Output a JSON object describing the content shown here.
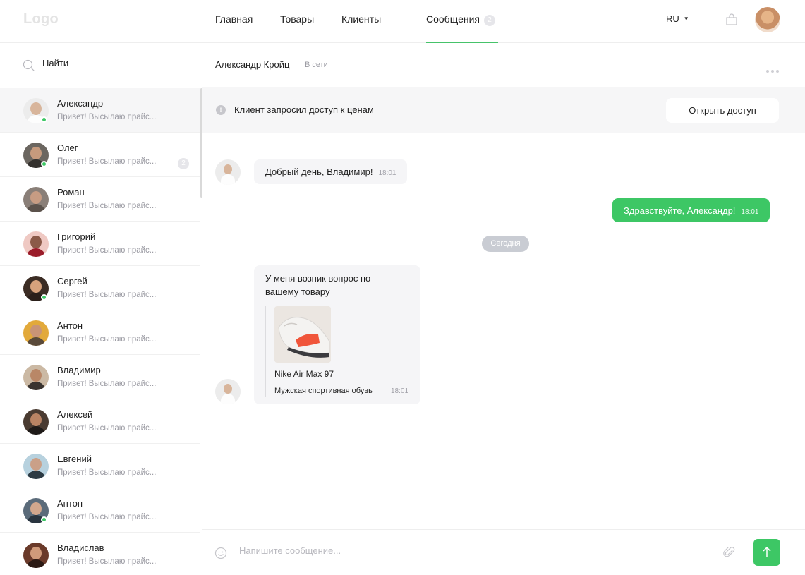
{
  "header": {
    "logo": "Logo",
    "nav": [
      {
        "label": "Главная"
      },
      {
        "label": "Товары"
      },
      {
        "label": "Клиенты"
      },
      {
        "label": "Сообщения",
        "badge": "2",
        "active": true
      }
    ],
    "language": "RU",
    "icons": {
      "cart": "shopping-bag-icon",
      "caret": "caret-down-icon"
    }
  },
  "sidebar": {
    "search_placeholder": "Найти",
    "contacts": [
      {
        "name": "Александр",
        "preview": "Привет! Высылаю прайс...",
        "online": true,
        "active": true
      },
      {
        "name": "Олег",
        "preview": "Привет! Высылаю прайс...",
        "online": true,
        "unread": "2"
      },
      {
        "name": "Роман",
        "preview": "Привет! Высылаю прайс..."
      },
      {
        "name": "Григорий",
        "preview": "Привет! Высылаю прайс..."
      },
      {
        "name": "Сергей",
        "preview": "Привет! Высылаю прайс...",
        "online": true
      },
      {
        "name": "Антон",
        "preview": "Привет! Высылаю прайс..."
      },
      {
        "name": "Владимир",
        "preview": "Привет! Высылаю прайс..."
      },
      {
        "name": "Алексей",
        "preview": "Привет! Высылаю прайс..."
      },
      {
        "name": "Евгений",
        "preview": "Привет! Высылаю прайс..."
      },
      {
        "name": "Антон",
        "preview": "Привет! Высылаю прайс...",
        "online": true
      },
      {
        "name": "Владислав",
        "preview": "Привет! Высылаю прайс..."
      }
    ]
  },
  "chat": {
    "contact_name": "Александр Кройц",
    "status": "В сети",
    "banner": {
      "text": "Клиент запросил доступ к ценам",
      "button": "Открыть доступ"
    },
    "messages": [
      {
        "direction": "in",
        "text": "Добрый день, Владимир!",
        "time": "18:01"
      },
      {
        "direction": "out",
        "text": "Здравствуйте, Александр!",
        "time": "18:01"
      }
    ],
    "date_separator": "Сегодня",
    "product_message": {
      "text": "У меня возник вопрос по вашему товару",
      "product_name": "Nike Air Max 97",
      "product_desc": "Мужская спортивная обувь",
      "time": "18:01"
    },
    "composer_placeholder": "Напишите сообщение..."
  },
  "colors": {
    "accent": "#3dc765",
    "muted": "#9a9aa2",
    "panel": "#f6f6f7"
  }
}
